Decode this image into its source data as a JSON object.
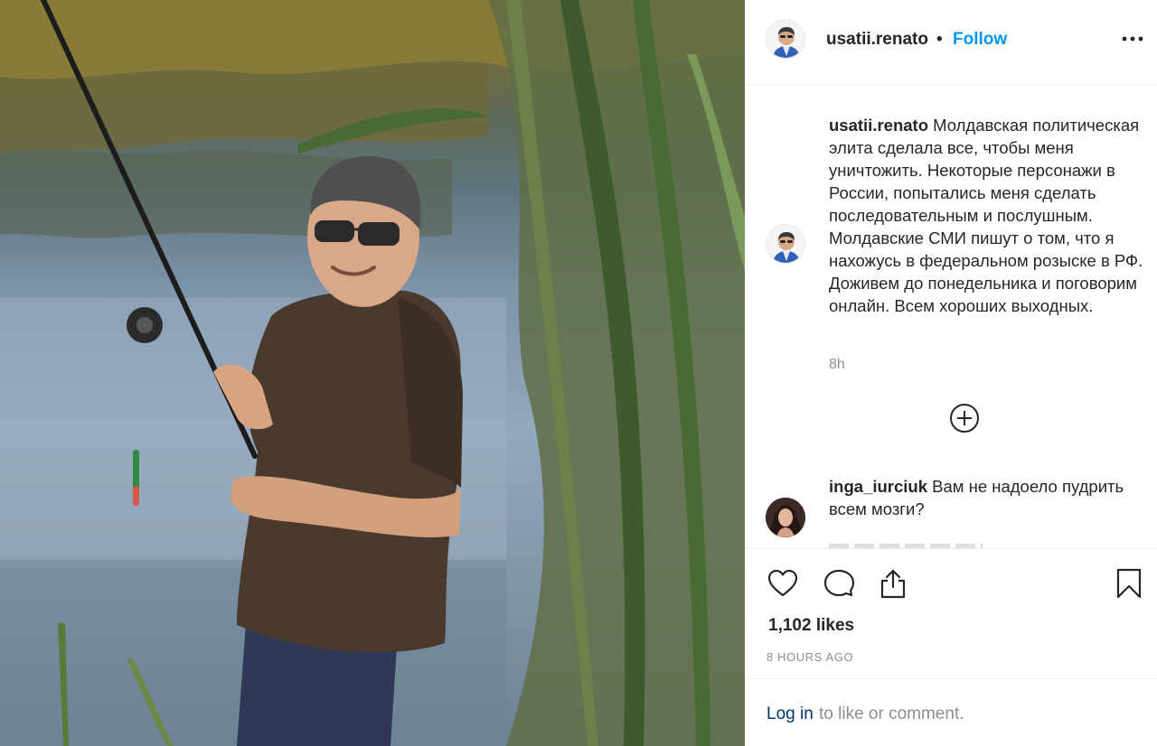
{
  "post": {
    "username": "usatii.renato",
    "separator": "•",
    "follow_label": "Follow",
    "more_icon": "more-horizontal-icon"
  },
  "caption": {
    "username": "usatii.renato",
    "text": " Молдавская политическая элита сделала все, чтобы меня уничтожить. Некоторые персонажи в России, попытались меня сделать последовательным и послушным. Молдавские СМИ пишут о том, что я нахожусь в федеральном розыске в РФ. Доживем до понедельника и поговорим онлайн. Всем хороших выходных.",
    "timestamp": "8h"
  },
  "load_more_icon": "plus-circle-icon",
  "comments": [
    {
      "username": "inga_iurciuk",
      "text": " Вам не надоело пудрить всем мозги?"
    }
  ],
  "actions": {
    "icons": [
      "heart-icon",
      "comment-icon",
      "share-icon",
      "bookmark-icon"
    ],
    "likes": "1,102 likes",
    "posted": "8 HOURS AGO"
  },
  "login": {
    "link": "Log in",
    "rest": " to like or comment."
  },
  "colors": {
    "link_blue": "#0095f6",
    "login_blue": "#00376b",
    "muted": "#8e8e8e",
    "text": "#262626"
  }
}
